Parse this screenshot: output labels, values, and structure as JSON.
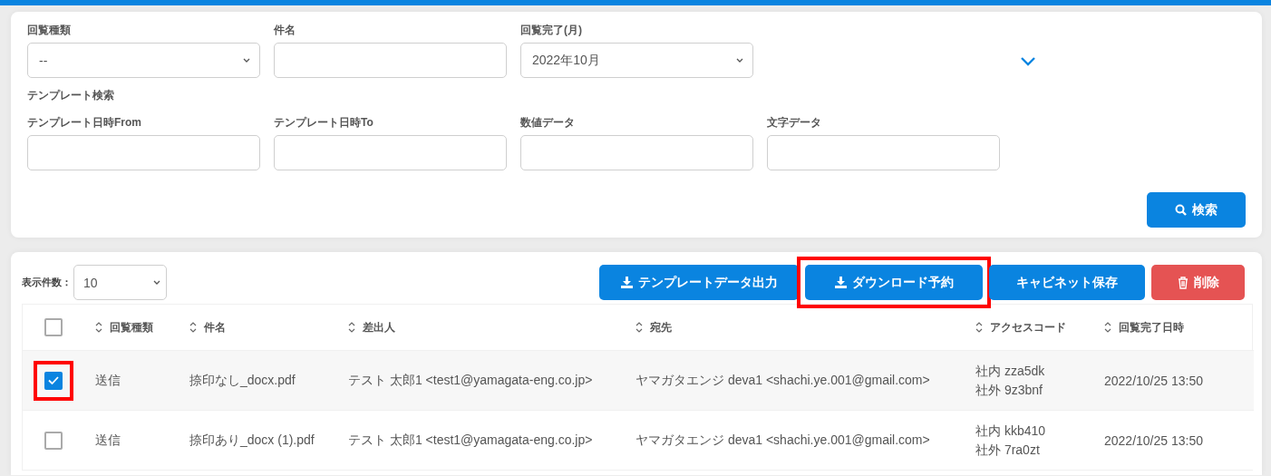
{
  "search_panel": {
    "fields": [
      {
        "label": "回覧種類",
        "kind": "select",
        "value": "--"
      },
      {
        "label": "件名",
        "kind": "text"
      },
      {
        "label": "回覧完了(月)",
        "kind": "select",
        "value": "2022年10月"
      }
    ],
    "template_search": {
      "title": "テンプレート検索",
      "fields": [
        {
          "label": "テンプレート日時From",
          "kind": "text"
        },
        {
          "label": "テンプレート日時To",
          "kind": "text"
        },
        {
          "label": "数値データ",
          "kind": "text"
        },
        {
          "label": "文字データ",
          "kind": "text"
        }
      ]
    },
    "search_button": "検索"
  },
  "results": {
    "page_size": {
      "label": "表示件数：",
      "value": "10"
    },
    "buttons": [
      {
        "label": "テンプレートデータ出力",
        "kind": "download",
        "highlighted": false
      },
      {
        "label": "ダウンロード予約",
        "kind": "download",
        "highlighted": true
      },
      {
        "label": "キャビネット保存",
        "kind": "plain",
        "highlighted": false
      },
      {
        "label": "削除",
        "kind": "delete",
        "highlighted": false
      }
    ],
    "table": {
      "select_all_checked": false,
      "columns": [
        "回覧種類",
        "件名",
        "差出人",
        "宛先",
        "アクセスコード",
        "回覧完了日時"
      ],
      "rows": [
        {
          "checked": true,
          "highlighted": true,
          "cells": [
            "送信",
            "捺印なし_docx.pdf",
            "テスト 太郎1 <test1@yamagata-eng.co.jp>",
            "ヤマガタエンジ deva1 <shachi.ye.001@gmail.com>",
            [
              "社内 zza5dk",
              "社外 9z3bnf"
            ],
            "2022/10/25 13:50"
          ]
        },
        {
          "checked": false,
          "highlighted": false,
          "cells": [
            "送信",
            "捺印あり_docx (1).pdf",
            "テスト 太郎1 <test1@yamagata-eng.co.jp>",
            "ヤマガタエンジ deva1 <shachi.ye.001@gmail.com>",
            [
              "社内 kkb410",
              "社外 7ra0zt"
            ],
            "2022/10/25 13:50"
          ]
        }
      ]
    }
  }
}
